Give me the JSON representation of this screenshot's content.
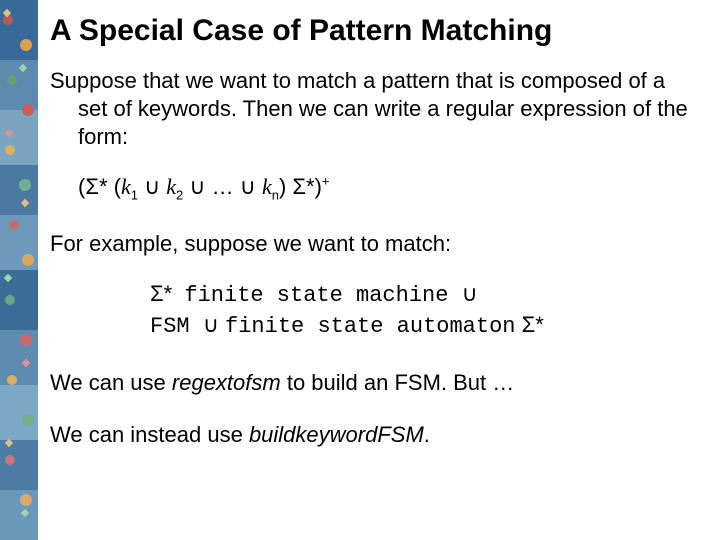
{
  "title": "A Special Case of Pattern Matching",
  "para1": "Suppose that we want to match a pattern that is composed of a set of keywords.  Then we can write a regular expression of the form:",
  "formula": {
    "open": "(",
    "sigma": "Σ",
    "star": "*",
    "sp": " (",
    "k": "k",
    "s1": "1",
    "cup": " ∪ ",
    "s2": "2",
    "dots": " ∪ … ∪ ",
    "sn": "n",
    "close1": ") ",
    "close2": ")",
    "plus": "+"
  },
  "para2": "For example, suppose we want to match:",
  "example": {
    "l1a": "Σ*  ",
    "l1b": "finite state machine ",
    "l1c": "∪",
    "l2a": "FSM ",
    "l2b": "∪ ",
    "l2c": "finite state automaton",
    "l2d": " Σ*"
  },
  "para3a": "We can use ",
  "para3b": "regextofsm",
  "para3c": " to build an FSM.  But …",
  "para4a": "We can instead use ",
  "para4b": "buildkeywordFSM",
  "para4c": "."
}
